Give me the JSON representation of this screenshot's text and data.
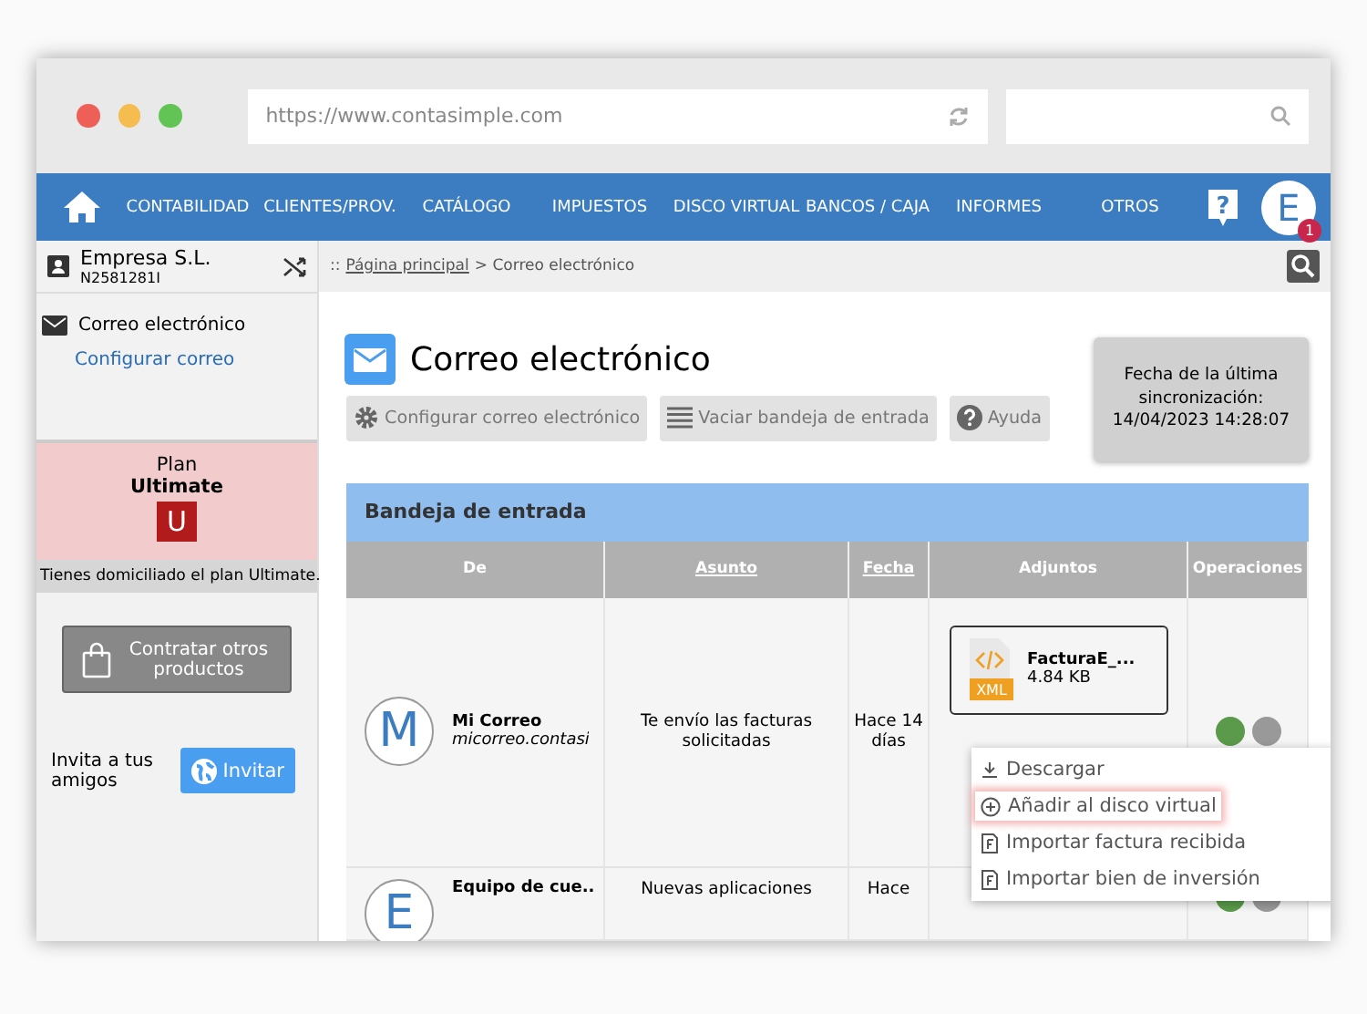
{
  "browser": {
    "url": "https://www.contasimple.com"
  },
  "nav": {
    "items": [
      "CONTABILIDAD",
      "CLIENTES/PROV.",
      "CATÁLOGO",
      "IMPUESTOS",
      "DISCO VIRTUAL",
      "BANCOS / CAJA",
      "INFORMES",
      "OTROS"
    ],
    "help": "?",
    "avatar": "E",
    "badge": "1"
  },
  "sidebar": {
    "company": "Empresa S.L.",
    "company_id": "N2581281I",
    "section": "Correo electrónico",
    "link": "Configurar correo",
    "plan": {
      "label": "Plan",
      "name": "Ultimate",
      "letter": "U",
      "note": "Tienes domiciliado el plan Ultimate."
    },
    "buy_button": "Contratar otros productos",
    "invite_text": "Invita a tus amigos",
    "invite_button": "Invitar"
  },
  "breadcrumb": {
    "prefix": "::",
    "link": "Página principal",
    "current": "> Correo electrónico"
  },
  "title": "Correo electrónico",
  "sync": "Fecha de la última sincronización: 14/04/2023 14:28:07",
  "toolbar": [
    {
      "kind": "gear",
      "label": "Configurar correo electrónico"
    },
    {
      "kind": "list",
      "label": "Vaciar bandeja de entrada"
    },
    {
      "kind": "help",
      "label": "Ayuda"
    }
  ],
  "inbox": {
    "title": "Bandeja de entrada",
    "columns": [
      {
        "label": "De",
        "sortable": false
      },
      {
        "label": "Asunto",
        "sortable": true
      },
      {
        "label": "Fecha",
        "sortable": true
      },
      {
        "label": "Adjuntos",
        "sortable": false
      },
      {
        "label": "Operaciones",
        "sortable": false
      }
    ],
    "rows": [
      {
        "avatar": "M",
        "name": "Mi Correo",
        "email": "micorreo.contasi",
        "subject": "Te envío las facturas solicitadas",
        "date": "Hace 14 días",
        "attachment": {
          "name": "FacturaE_...",
          "size": "4.84 KB",
          "type": "XML"
        }
      },
      {
        "avatar": "E",
        "name": "Equipo de cue...",
        "subject": "Nuevas aplicaciones",
        "date": "Hace"
      }
    ]
  },
  "menu": [
    {
      "kind": "download",
      "label": "Descargar",
      "selected": false
    },
    {
      "kind": "add",
      "label": "Añadir al disco virtual",
      "selected": true
    },
    {
      "kind": "file",
      "label": "Importar factura recibida",
      "selected": false
    },
    {
      "kind": "file",
      "label": "Importar bien de inversión",
      "selected": false
    }
  ]
}
